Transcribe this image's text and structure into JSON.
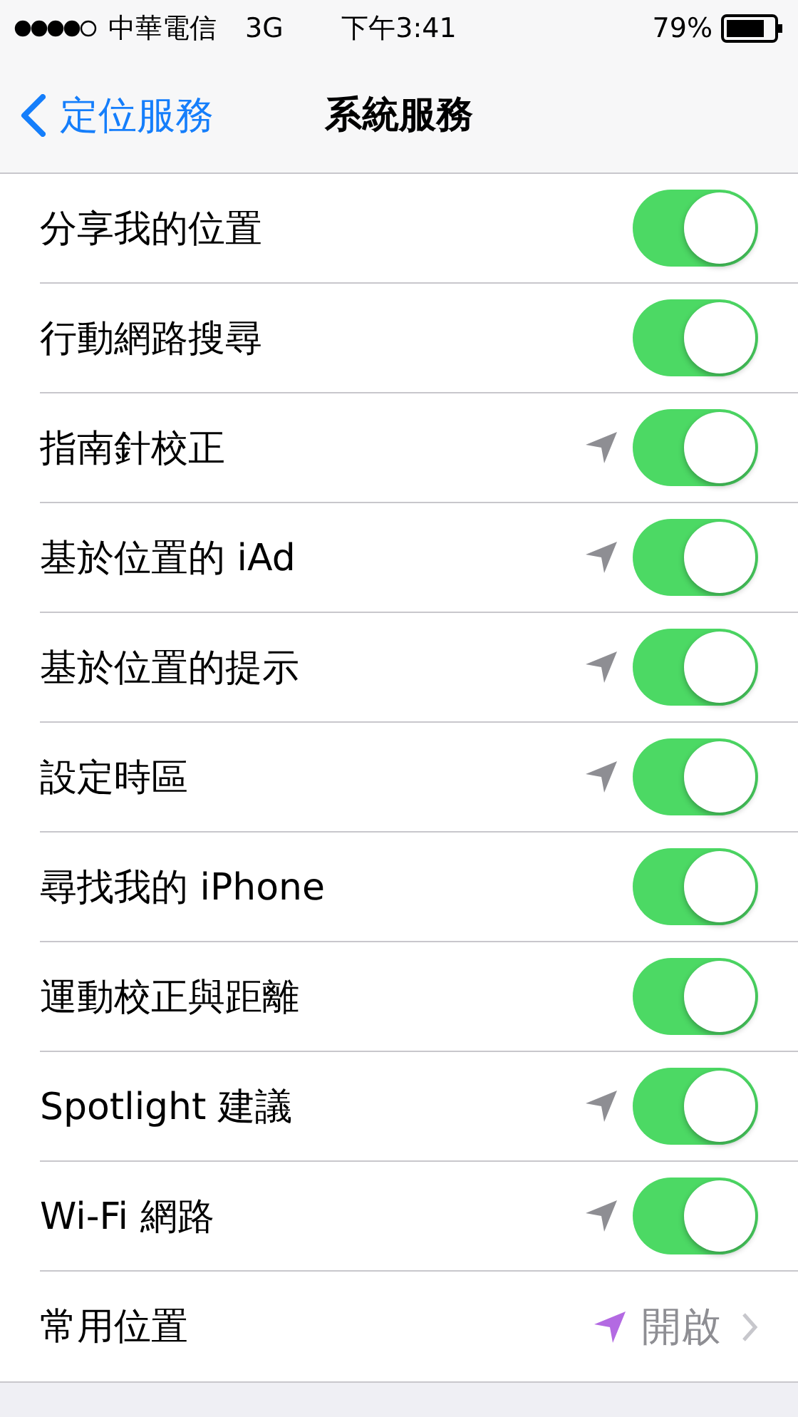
{
  "status_bar": {
    "carrier": "中華電信",
    "network": "3G",
    "time": "下午3:41",
    "battery": "79%"
  },
  "nav": {
    "back": "定位服務",
    "title": "系統服務"
  },
  "rows": [
    {
      "kind": "toggle",
      "label": "分享我的位置",
      "location_icon": false,
      "on": true
    },
    {
      "kind": "toggle",
      "label": "行動網路搜尋",
      "location_icon": false,
      "on": true
    },
    {
      "kind": "toggle",
      "label": "指南針校正",
      "location_icon": true,
      "on": true
    },
    {
      "kind": "toggle",
      "label": "基於位置的 iAd",
      "location_icon": true,
      "on": true
    },
    {
      "kind": "toggle",
      "label": "基於位置的提示",
      "location_icon": true,
      "on": true
    },
    {
      "kind": "toggle",
      "label": "設定時區",
      "location_icon": true,
      "on": true
    },
    {
      "kind": "toggle",
      "label": "尋找我的 iPhone",
      "location_icon": false,
      "on": true
    },
    {
      "kind": "toggle",
      "label": "運動校正與距離",
      "location_icon": false,
      "on": true
    },
    {
      "kind": "toggle",
      "label": "Spotlight 建議",
      "location_icon": true,
      "on": true
    },
    {
      "kind": "toggle",
      "label": "Wi-Fi 網路",
      "location_icon": true,
      "on": true
    },
    {
      "kind": "detail",
      "label": "常用位置",
      "location_icon": true,
      "value": "開啟"
    }
  ]
}
